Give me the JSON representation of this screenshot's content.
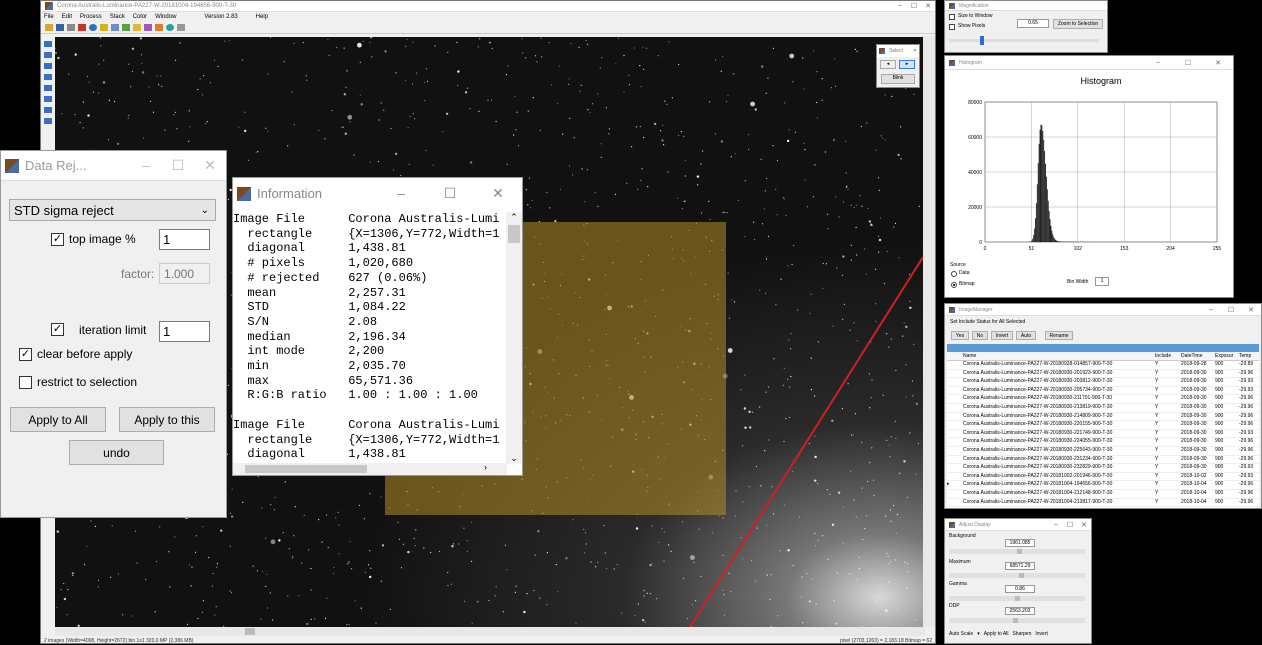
{
  "main": {
    "title": "Corona Australis-Luminance-PA227-W-20181004-194656-900-T-30",
    "menus": [
      "File",
      "Edit",
      "Process",
      "Stack",
      "Color",
      "Window"
    ],
    "version": "Version 2.83",
    "help": "Help",
    "status_left": "2 images  (Width=4008, Height=2672) bin 1x1  320.0 MP (2,386 MB)",
    "status_right": "pixel (2703,1263) = 2,183.18  Bitmap = 62"
  },
  "select_tool": {
    "title": "Select",
    "label": "Blink"
  },
  "data_reject": {
    "title": "Data Rej...",
    "mode": "STD sigma reject",
    "top_image_label": "top image %",
    "top_image_value": "1",
    "factor_label": "factor:",
    "factor_value": "1.000",
    "iteration_label": "iteration limit",
    "iteration_value": "1",
    "clear_label": "clear before apply",
    "restrict_label": "restrict to selection",
    "apply_all": "Apply to All",
    "apply_this": "Apply to this",
    "undo": "undo"
  },
  "info": {
    "title": "Information",
    "blocks": [
      {
        "rows": [
          [
            "Image File",
            "Corona Australis-Lumi"
          ],
          [
            "  rectangle",
            "{X=1306,Y=772,Width=1"
          ],
          [
            "  diagonal",
            "1,438.81"
          ],
          [
            "  # pixels",
            "1,020,680"
          ],
          [
            "  # rejected",
            "627 (0.06%)"
          ],
          [
            "  mean",
            "2,257.31"
          ],
          [
            "  STD",
            "1,084.22"
          ],
          [
            "  S/N",
            "2.08"
          ],
          [
            "  median",
            "2,196.34"
          ],
          [
            "  int mode",
            "2,200"
          ],
          [
            "  min",
            "2,035.70"
          ],
          [
            "  max",
            "65,571.36"
          ],
          [
            "  R:G:B ratio",
            "1.00 : 1.00 : 1.00"
          ]
        ]
      },
      {
        "rows": [
          [
            "Image File",
            "Corona Australis-Lumi"
          ],
          [
            "  rectangle",
            "{X=1306,Y=772,Width=1"
          ],
          [
            "  diagonal",
            "1,438.81"
          ]
        ]
      }
    ]
  },
  "magnification": {
    "title": "Magnification",
    "size_to_window": "Size to Window",
    "show_pixels": "Show Pixels",
    "value": "0.65",
    "zoom_button": "Zoom to Selection"
  },
  "histogram": {
    "title": "Histogram",
    "chart_title": "Histogram",
    "source_label": "Source",
    "opt_data": "Data",
    "opt_bitmap": "Bitmap",
    "bin_width_label": "Bin Width",
    "bin_width_value": "1"
  },
  "chart_data": {
    "type": "bar",
    "title": "Histogram",
    "x_ticks": [
      "0",
      "51",
      "102",
      "153",
      "204",
      "255"
    ],
    "y_ticks": [
      "0",
      "20000",
      "40000",
      "60000",
      "80000"
    ],
    "xlim": [
      0,
      255
    ],
    "ylim": [
      0,
      80000
    ],
    "peak_x": 61,
    "peak_y": 67000,
    "grid": true
  },
  "image_manager": {
    "title": "ImageManager",
    "hint": "Set Include Status for All Selected",
    "buttons": [
      "Yes",
      "No",
      "Invert",
      "Auto",
      "Rename"
    ],
    "columns": [
      "Name",
      "Include",
      "DateTime",
      "Exposur",
      "Temp"
    ],
    "rows": [
      [
        "Corona Australis-Luminance-PA227-W-20180928-014857-900-T-30",
        "Y",
        "2018-09-28",
        "900",
        "-29.89"
      ],
      [
        "Corona Australis-Luminance-PA227-W-20180930-201923-900-T-30",
        "Y",
        "2018-09-30",
        "900",
        "-29.96"
      ],
      [
        "Corona Australis-Luminance-PA227-W-20180930-203812-900-T-30",
        "Y",
        "2018-09-30",
        "900",
        "-29.93"
      ],
      [
        "Corona Australis-Luminance-PA227-W-20180930-205734-900-T-30",
        "Y",
        "2018-09-30",
        "900",
        "-29.93"
      ],
      [
        "Corona Australis-Luminance-PA227-W-20180930-211701-900-T-30",
        "Y",
        "2018-09-30",
        "900",
        "-29.96"
      ],
      [
        "Corona Australis-Luminance-PA227-W-20180930-213819-900-T-30",
        "Y",
        "2018-09-30",
        "900",
        "-29.96"
      ],
      [
        "Corona Australis-Luminance-PA227-W-20180930-214809-900-T-30",
        "Y",
        "2018-09-30",
        "900",
        "-29.96"
      ],
      [
        "Corona Australis-Luminance-PA227-W-20180930-220155-900-T-30",
        "Y",
        "2018-09-30",
        "900",
        "-29.96"
      ],
      [
        "Corona Australis-Luminance-PA227-W-20180930-221749-900-T-30",
        "Y",
        "2018-09-30",
        "900",
        "-29.93"
      ],
      [
        "Corona Australis-Luminance-PA227-W-20180930-224055-900-T-30",
        "Y",
        "2018-09-30",
        "900",
        "-29.96"
      ],
      [
        "Corona Australis-Luminance-PA227-W-20180930-225643-900-T-30",
        "Y",
        "2018-09-30",
        "900",
        "-29.96"
      ],
      [
        "Corona Australis-Luminance-PA227-W-20180930-231234-900-T-30",
        "Y",
        "2018-09-30",
        "900",
        "-29.96"
      ],
      [
        "Corona Australis-Luminance-PA227-W-20180930-232829-900-T-30",
        "Y",
        "2018-09-30",
        "900",
        "-29.93"
      ],
      [
        "Corona Australis-Luminance-PA227-W-20181002-201946-900-T-30",
        "Y",
        "2018-10-02",
        "900",
        "-29.93"
      ],
      [
        "Corona Australis-Luminance-PA227-W-20181004-194656-900-T-30",
        "Y",
        "2018-10-04",
        "900",
        "-29.96"
      ],
      [
        "Corona Australis-Luminance-PA227-W-20181004-212148-900-T-30",
        "Y",
        "2018-10-04",
        "900",
        "-29.96"
      ],
      [
        "Corona Australis-Luminance-PA227-W-20181004-213817-900-T-30",
        "Y",
        "2018-10-04",
        "900",
        "-29.96"
      ]
    ]
  },
  "adjust_display": {
    "title": "Adjust Display",
    "background_label": "Background",
    "background_value": "1961.085",
    "maximum_label": "Maximum",
    "maximum_value": "68571.29",
    "gamma_label": "Gamma",
    "gamma_value": "0.86",
    "ddp_label": "DDP",
    "ddp_value": "2563.203",
    "auto_scale": "Auto Scale",
    "apply_all": "Apply to All",
    "sharpen": "Sharpen",
    "invert": "Invert"
  }
}
